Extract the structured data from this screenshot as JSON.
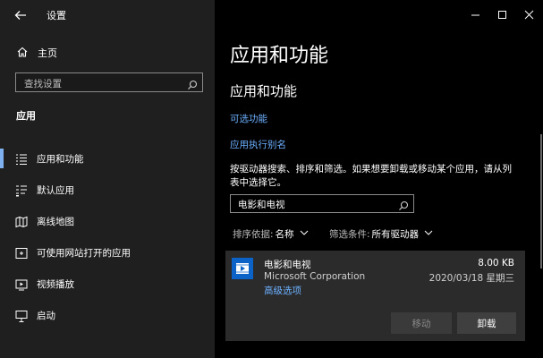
{
  "window": {
    "title": "设置"
  },
  "sidebar": {
    "home_label": "主页",
    "search_placeholder": "查找设置",
    "section_title": "应用",
    "items": [
      {
        "label": "应用和功能",
        "icon": "apps-features-icon",
        "selected": true
      },
      {
        "label": "默认应用",
        "icon": "default-apps-icon",
        "selected": false
      },
      {
        "label": "离线地图",
        "icon": "offline-maps-icon",
        "selected": false
      },
      {
        "label": "可使用网站打开的应用",
        "icon": "apps-for-websites-icon",
        "selected": false
      },
      {
        "label": "视频播放",
        "icon": "video-playback-icon",
        "selected": false
      },
      {
        "label": "启动",
        "icon": "startup-icon",
        "selected": false
      }
    ]
  },
  "main": {
    "page_title": "应用和功能",
    "section_title": "应用和功能",
    "link_optional_features": "可选功能",
    "link_app_exec_aliases": "应用执行别名",
    "description": "按驱动器搜索、排序和筛选。如果想要卸载或移动某个应用，请从列表中选择它。",
    "filter_value": "电影和电视",
    "sort": {
      "label": "排序依据:",
      "value": "名称"
    },
    "filter_cond": {
      "label": "筛选条件:",
      "value": "所有驱动器"
    },
    "app": {
      "name": "电影和电视",
      "publisher": "Microsoft Corporation",
      "advanced_link": "高级选项",
      "size": "8.00 KB",
      "date": "2020/03/18 星期三",
      "move_label": "移动",
      "uninstall_label": "卸载"
    }
  },
  "colors": {
    "accent": "#6cb0ff",
    "selection_bar": "#7fb0f0",
    "app_icon_bg": "#0b63c7"
  }
}
